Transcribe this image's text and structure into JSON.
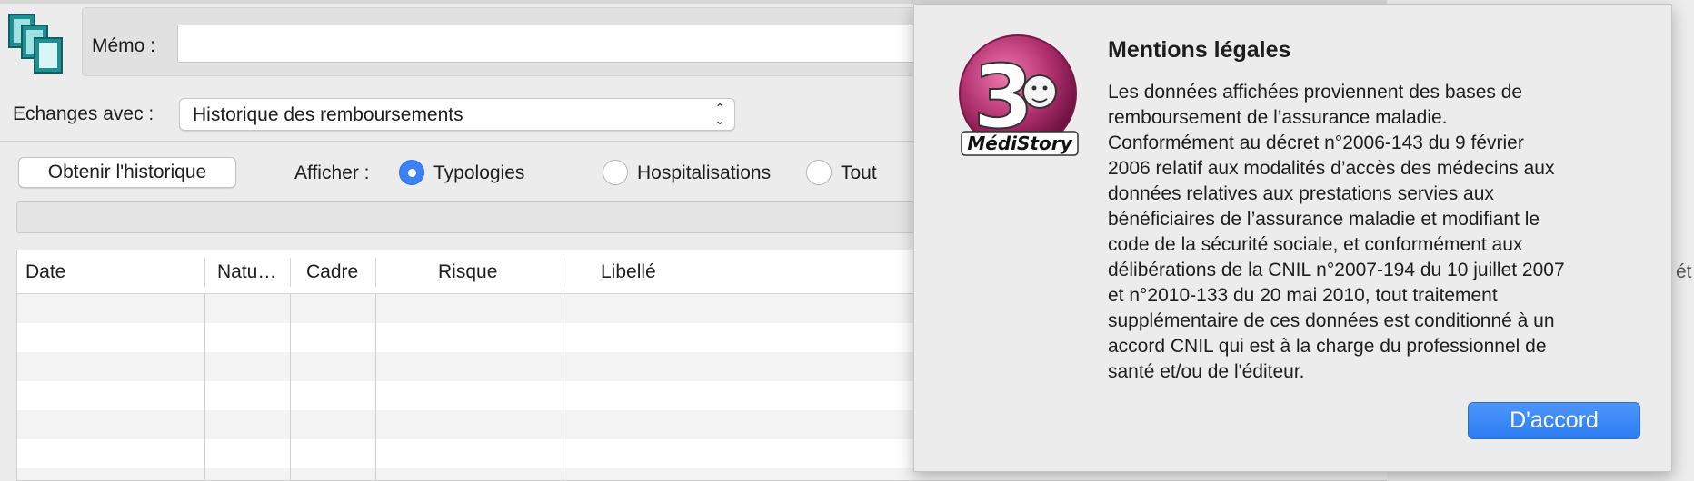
{
  "memo": {
    "label": "Mémo :",
    "value": ""
  },
  "exchanges": {
    "label": "Echanges avec :",
    "selected": "Historique des remboursements"
  },
  "toolbar": {
    "history_button": "Obtenir l'historique",
    "show_label": "Afficher :"
  },
  "radios": [
    {
      "label": "Typologies",
      "checked": true
    },
    {
      "label": "Hospitalisations",
      "checked": false
    },
    {
      "label": "Tout",
      "checked": false
    }
  ],
  "table": {
    "columns": [
      "Date",
      "Natu…",
      "Cadre",
      "Risque",
      "Libellé"
    ],
    "rows": [],
    "edge_fragment": "ét"
  },
  "dialog": {
    "title": "Mentions légales",
    "body": "Les données affichées proviennent des bases de\nremboursement de l’assurance maladie.\nConformément au décret n°2006-143 du 9 février\n2006 relatif aux modalités d’accès des médecins aux\ndonnées relatives aux prestations servies aux\nbénéficiaires de l’assurance maladie et modifiant le\ncode de la sécurité sociale, et conformément aux\ndélibérations de la CNIL n°2007-194 du 10 juillet 2007\net n°2010-133 du 20 mai 2010, tout traitement\nsupplémentaire de ces données est conditionné à un\naccord CNIL qui est à la charge du professionnel de\nsanté et/ou de l'éditeur.",
    "ok_label": "D'accord",
    "logo_text": "MédiStory",
    "logo_number": "3"
  },
  "colors": {
    "accent": "#3b82f7",
    "logo_magenta": "#b0306e"
  }
}
